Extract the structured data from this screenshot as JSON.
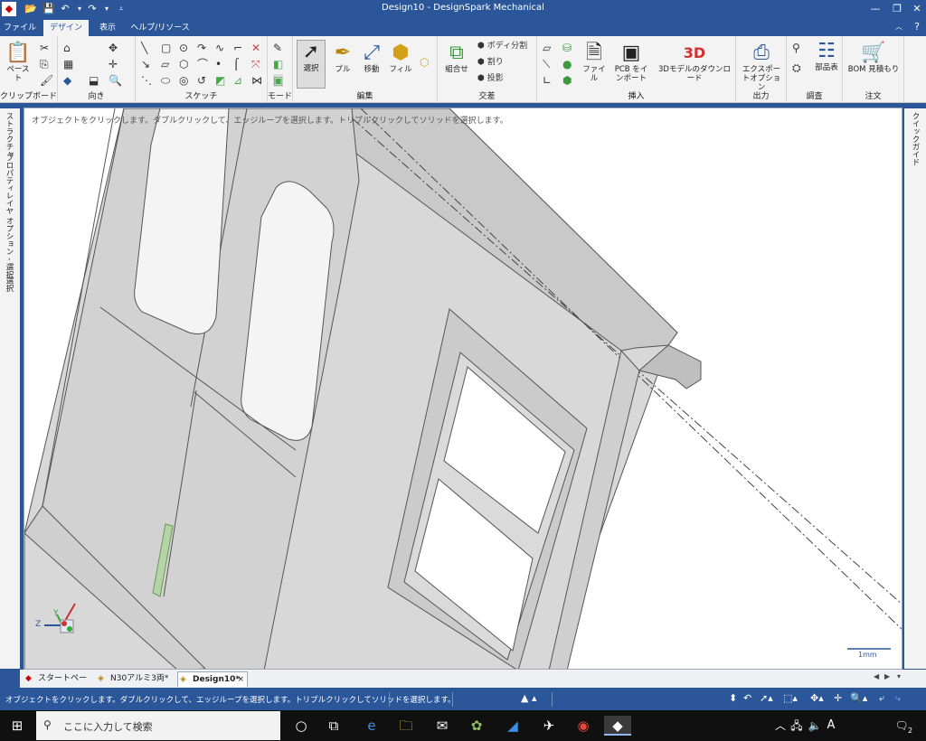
{
  "app": {
    "title": "Design10 - DesignSpark Mechanical"
  },
  "window_controls": {
    "minimize": "—",
    "restore": "❐",
    "close": "✕"
  },
  "tabs": [
    {
      "label": "ファイル"
    },
    {
      "label": "デザイン"
    },
    {
      "label": "表示"
    },
    {
      "label": "ヘルプ/リソース"
    }
  ],
  "ribbon": {
    "groups": {
      "clipboard": "クリップボード",
      "orient": "向き",
      "sketch": "スケッチ",
      "mode": "モード",
      "edit": "編集",
      "intersect": "交差",
      "insert": "挿入",
      "output": "出力",
      "inspect": "調査",
      "order": "注文"
    },
    "buttons": {
      "paste": "ペースト",
      "select": "選択",
      "pull": "プル",
      "move": "移動",
      "fill": "フィル",
      "combine": "組合せ",
      "split_body": "ボディ分割",
      "split": "割り",
      "project": "投影",
      "file": "ファイル",
      "pcb_import": "PCB をインポート",
      "download_3d": "3Dモデルのダウンロード",
      "export_options": "エクスポートオプション",
      "bom": "部品表",
      "bom_quote": "BOM 見積もり"
    },
    "icon_3d_text": "3D"
  },
  "left_panel_tabs": [
    "ストラクチャ",
    "プロパティ",
    "レイヤ",
    "オプション - 選択",
    "選択"
  ],
  "right_panel_tabs": [
    "クイックガイド"
  ],
  "viewport": {
    "hint": "オブジェクトをクリックします。ダブルクリックして、エッジループを選択します。トリプルクリックしてソリッドを選択します。",
    "scale_label": "1mm",
    "axis": {
      "z": "Z",
      "y": "Y"
    }
  },
  "doc_tabs": [
    {
      "label": "スタートページ"
    },
    {
      "label": "N30アルミ3両*"
    },
    {
      "label": "Design10*"
    }
  ],
  "status": {
    "message": "オブジェクトをクリックします。ダブルクリックして、エッジループを選択します。トリプルクリックしてソリッドを選択します。"
  },
  "taskbar": {
    "search_placeholder": "ここに入力して検索",
    "ime": "A",
    "notifications": "2"
  }
}
